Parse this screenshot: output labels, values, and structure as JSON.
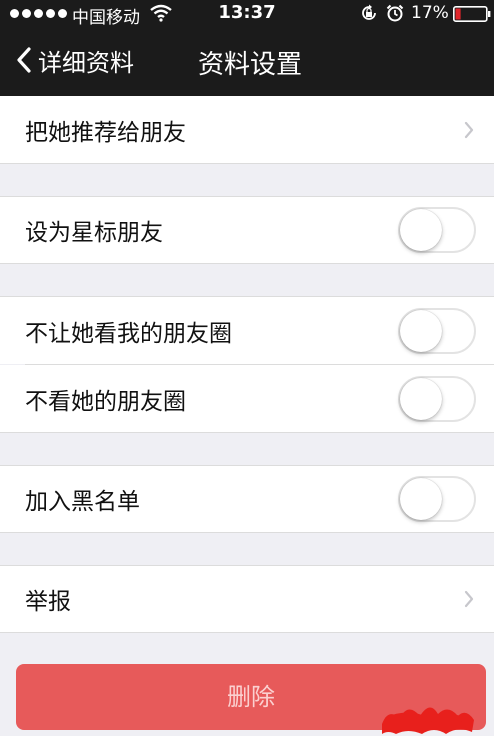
{
  "status_bar": {
    "carrier": "中国移动",
    "time": "13:37",
    "battery_percent": "17%",
    "battery_level": 0.17,
    "icons": [
      "signal-dots-icon",
      "wifi-icon",
      "orientation-lock-icon",
      "alarm-icon",
      "battery-icon"
    ]
  },
  "nav": {
    "back_label": "详细资料",
    "title": "资料设置"
  },
  "rows": {
    "recommend": "把她推荐给朋友",
    "star_friend": "设为星标朋友",
    "hide_my_moments": "不让她看我的朋友圈",
    "hide_her_moments": "不看她的朋友圈",
    "blacklist": "加入黑名单",
    "report": "举报"
  },
  "toggles": {
    "star_friend": false,
    "hide_my_moments": false,
    "hide_her_moments": false,
    "blacklist": false
  },
  "delete_label": "删除",
  "colors": {
    "nav_background": "#1b1b1b",
    "page_background": "#efeff4",
    "delete_button": "#e75a5a",
    "battery_low": "#e0262b"
  }
}
